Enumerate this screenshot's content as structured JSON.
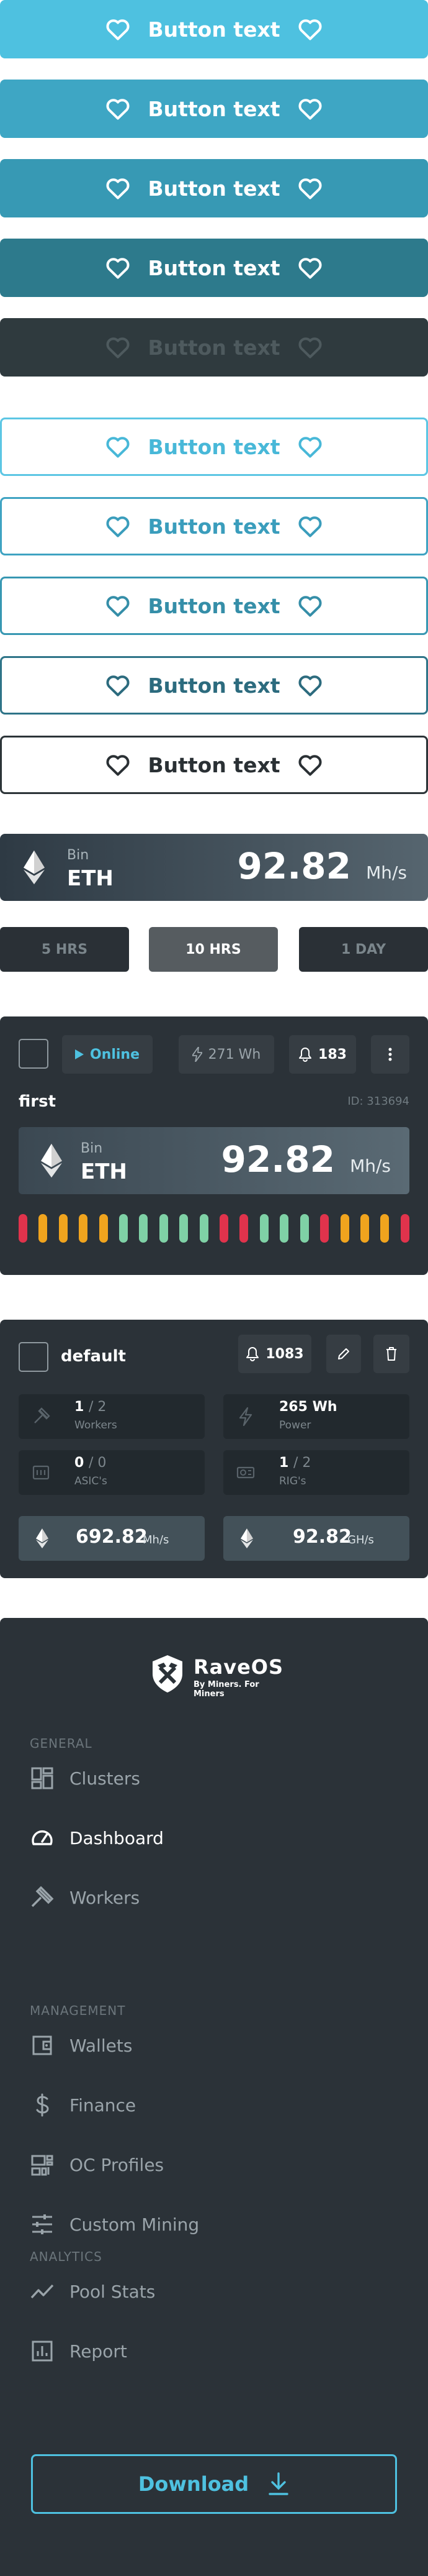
{
  "buttons": {
    "filled": [
      "Button text",
      "Button text",
      "Button text",
      "Button text",
      "Button text"
    ],
    "outline": [
      "Button text",
      "Button text",
      "Button text",
      "Button text",
      "Button text"
    ]
  },
  "hashrate_widget": {
    "coin_label": "Bin",
    "coin": "ETH",
    "value": "92.82",
    "unit": "Mh/s"
  },
  "time_tabs": [
    {
      "label": "5 HRS",
      "active": false
    },
    {
      "label": "10 HRS",
      "active": true
    },
    {
      "label": "1 DAY",
      "active": false
    }
  ],
  "worker_card": {
    "status": "Online",
    "power": "271 Wh",
    "alerts": "183",
    "name": "first",
    "id": "ID: 313694",
    "coin_label": "Bin",
    "coin": "ETH",
    "value": "92.82",
    "unit": "Mh/s",
    "bar_colors": [
      "#e0334c",
      "#f0a41e",
      "#f0a41e",
      "#f0a41e",
      "#f0a41e",
      "#7fd1a6",
      "#7fd1a6",
      "#7fd1a6",
      "#7fd1a6",
      "#7fd1a6",
      "#e0334c",
      "#e0334c",
      "#7fd1a6",
      "#7fd1a6",
      "#7fd1a6",
      "#e0334c",
      "#f0a41e",
      "#f0a41e",
      "#f0a41e",
      "#e0334c"
    ]
  },
  "cluster_card": {
    "name": "default",
    "alerts": "1083",
    "workers": {
      "value": "1",
      "total": "/ 2",
      "label": "Workers"
    },
    "power": {
      "value": "265 Wh",
      "label": "Power"
    },
    "asics": {
      "value": "0",
      "total": "/ 0",
      "label": "ASIC's"
    },
    "rigs": {
      "value": "1",
      "total": "/ 2",
      "label": "RIG's"
    },
    "hash1": {
      "value": "692.82",
      "unit": "Mh/s"
    },
    "hash2": {
      "value": "92.82",
      "unit": "GH/s"
    }
  },
  "sidebar": {
    "logo_title": "RaveOS",
    "logo_sub": "By Miners. For Miners",
    "sections": [
      "GENERAL",
      "MANAGEMENT",
      "ANALYTICS"
    ],
    "items": [
      {
        "label": "Clusters",
        "icon": "clusters-icon",
        "active": false
      },
      {
        "label": "Dashboard",
        "icon": "dashboard-icon",
        "active": true
      },
      {
        "label": "Workers",
        "icon": "workers-icon",
        "active": false
      },
      {
        "label": "Wallets",
        "icon": "wallet-icon",
        "active": false
      },
      {
        "label": "Finance",
        "icon": "dollar-icon",
        "active": false
      },
      {
        "label": "OC Profiles",
        "icon": "oc-profiles-icon",
        "active": false
      },
      {
        "label": "Custom Mining",
        "icon": "sliders-icon",
        "active": false
      },
      {
        "label": "Pool Stats",
        "icon": "chart-line-icon",
        "active": false
      },
      {
        "label": "Report",
        "icon": "report-icon",
        "active": false
      }
    ],
    "download_label": "Download"
  },
  "colors": {
    "accent": "#4ec1e0",
    "dark": "#2b3238"
  }
}
